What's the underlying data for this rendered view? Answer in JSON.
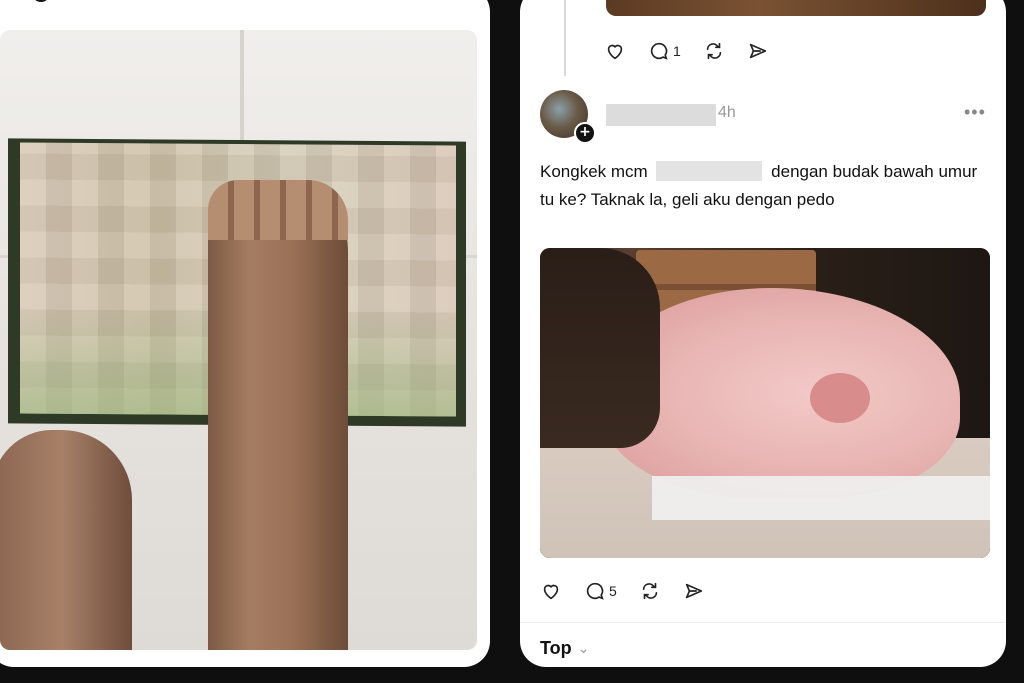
{
  "left_post": {
    "plus_symbol": "+"
  },
  "right_post": {
    "previous_post_actions": {
      "reply_count": "1"
    },
    "author": {
      "plus_symbol": "+"
    },
    "timestamp": "4h",
    "more_glyph": "•••",
    "text_parts": {
      "part1": "Kongkek mcm",
      "part2": "dengan budak bawah umur tu ke? Taknak la, geli aku dengan pedo"
    },
    "actions": {
      "reply_count": "5"
    }
  },
  "feed_tab": {
    "label": "Top"
  },
  "icons": [
    "heart-icon",
    "comment-icon",
    "repost-icon",
    "share-icon",
    "chevron-down-icon"
  ],
  "colors": {
    "background": "#0f0f0f",
    "card": "#ffffff",
    "text": "#111111",
    "muted": "#999999"
  }
}
